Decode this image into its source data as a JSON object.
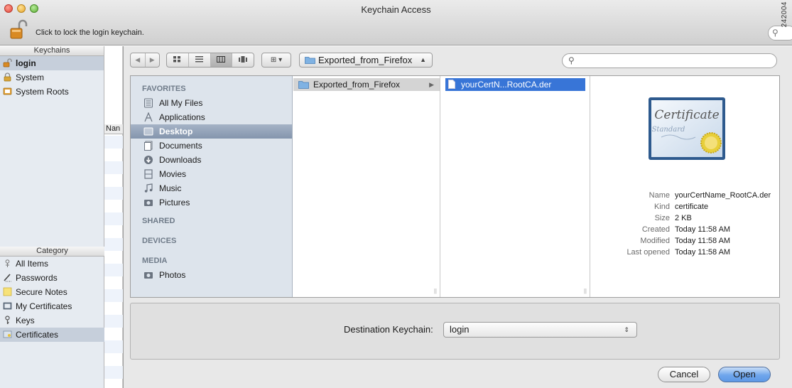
{
  "window": {
    "title": "Keychain Access",
    "lock_label": "Click to lock the login keychain.",
    "figure_id": "242004"
  },
  "sidebar": {
    "keychains_header": "Keychains",
    "keychains": [
      {
        "label": "login",
        "icon": "unlocked-keychain-icon",
        "selected": true
      },
      {
        "label": "System",
        "icon": "locked-keychain-icon",
        "selected": false
      },
      {
        "label": "System Roots",
        "icon": "folder-keychain-icon",
        "selected": false
      }
    ],
    "category_header": "Category",
    "categories": [
      {
        "label": "All Items",
        "icon": "all-items-icon",
        "selected": false
      },
      {
        "label": "Passwords",
        "icon": "pencil-icon",
        "selected": false
      },
      {
        "label": "Secure Notes",
        "icon": "note-icon",
        "selected": false
      },
      {
        "label": "My Certificates",
        "icon": "certificate-card-icon",
        "selected": false
      },
      {
        "label": "Keys",
        "icon": "key-icon",
        "selected": false
      },
      {
        "label": "Certificates",
        "icon": "certificate-icon",
        "selected": true
      }
    ],
    "name_column_header": "Nan"
  },
  "dialog": {
    "nav": {
      "back": "◀",
      "forward": "▶"
    },
    "view_buttons": [
      "icon-view",
      "list-view",
      "column-view",
      "coverflow-view"
    ],
    "active_view": "column-view",
    "arrange_button": "⊞ ▾",
    "path_popup": "Exported_from_Firefox",
    "search_placeholder": "",
    "favorites": {
      "header": "FAVORITES",
      "items": [
        {
          "label": "All My Files",
          "icon": "all-files-icon",
          "selected": false
        },
        {
          "label": "Applications",
          "icon": "applications-icon",
          "selected": false
        },
        {
          "label": "Desktop",
          "icon": "desktop-icon",
          "selected": true
        },
        {
          "label": "Documents",
          "icon": "documents-icon",
          "selected": false
        },
        {
          "label": "Downloads",
          "icon": "downloads-icon",
          "selected": false
        },
        {
          "label": "Movies",
          "icon": "movies-icon",
          "selected": false
        },
        {
          "label": "Music",
          "icon": "music-icon",
          "selected": false
        },
        {
          "label": "Pictures",
          "icon": "pictures-icon",
          "selected": false
        }
      ],
      "shared_header": "SHARED",
      "devices_header": "DEVICES",
      "media_header": "MEDIA",
      "media_items": [
        {
          "label": "Photos",
          "icon": "camera-icon"
        }
      ]
    },
    "column1": [
      {
        "label": "Exported_from_Firefox",
        "icon": "folder-icon",
        "has_children": true
      }
    ],
    "column2": [
      {
        "label": "yourCertN...RootCA.der",
        "icon": "document-icon",
        "selected": true
      }
    ],
    "preview": {
      "certificate_title": "Certificate",
      "certificate_subtitle": "Standard",
      "info": [
        {
          "key": "Name",
          "value": "yourCertName_RootCA.der"
        },
        {
          "key": "Kind",
          "value": "certificate"
        },
        {
          "key": "Size",
          "value": "2 KB"
        },
        {
          "key": "Created",
          "value": "Today 11:58 AM"
        },
        {
          "key": "Modified",
          "value": "Today 11:58 AM"
        },
        {
          "key": "Last opened",
          "value": "Today 11:58 AM"
        }
      ]
    },
    "destination_label": "Destination Keychain:",
    "destination_value": "login",
    "cancel_label": "Cancel",
    "open_label": "Open"
  },
  "colors": {
    "selection_blue": "#3875d7",
    "sidebar_bg": "#e6ebf1",
    "favorites_bg": "#dde4ec"
  }
}
